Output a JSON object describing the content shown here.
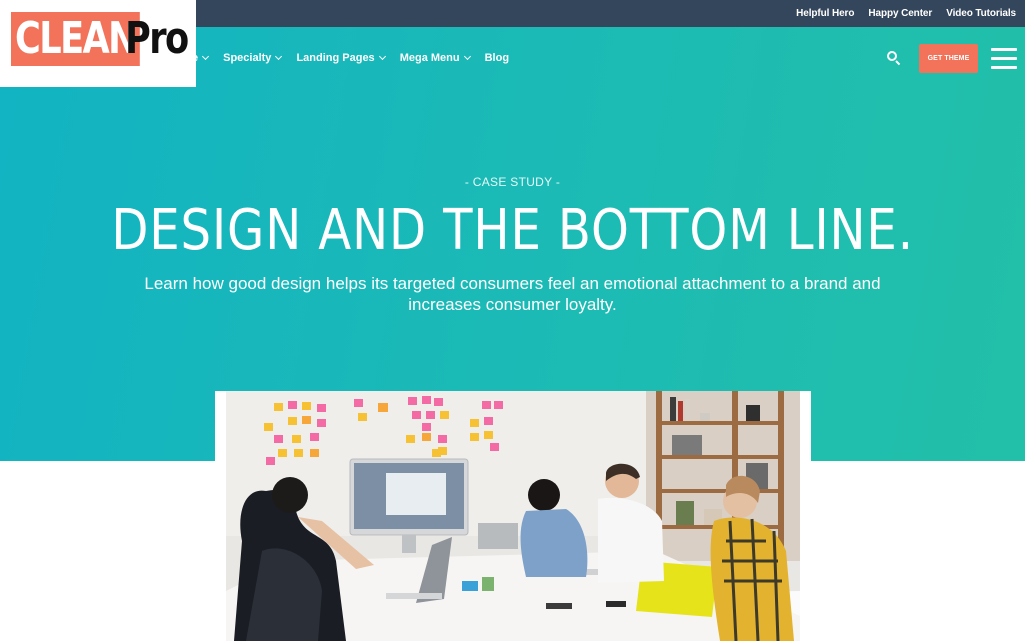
{
  "brand": {
    "logo_clean": "CLEAN",
    "logo_pro": "Pro",
    "accent": "#f2735a",
    "topbar_color": "#34465c",
    "hero_start": "#12b3c3",
    "hero_end": "#22c0a8"
  },
  "topbar": {
    "links": [
      "Helpful Hero",
      "Happy Center",
      "Video Tutorials"
    ]
  },
  "nav": {
    "items": [
      {
        "label": "e",
        "has_dropdown": true
      },
      {
        "label": "Specialty",
        "has_dropdown": true
      },
      {
        "label": "Landing Pages",
        "has_dropdown": true
      },
      {
        "label": "Mega Menu",
        "has_dropdown": true
      },
      {
        "label": "Blog",
        "has_dropdown": false
      }
    ],
    "search_icon": "search-icon",
    "cta_label": "GET THEME",
    "menu_icon": "hamburger-icon"
  },
  "hero": {
    "eyebrow": "- CASE STUDY -",
    "headline": "DESIGN AND THE BOTTOM LINE.",
    "lede": "Learn how good design helps its targeted consumers feel an emotional attachment to a brand and increases consumer loyalty."
  },
  "photo": {
    "subject": "team-meeting-photo"
  }
}
